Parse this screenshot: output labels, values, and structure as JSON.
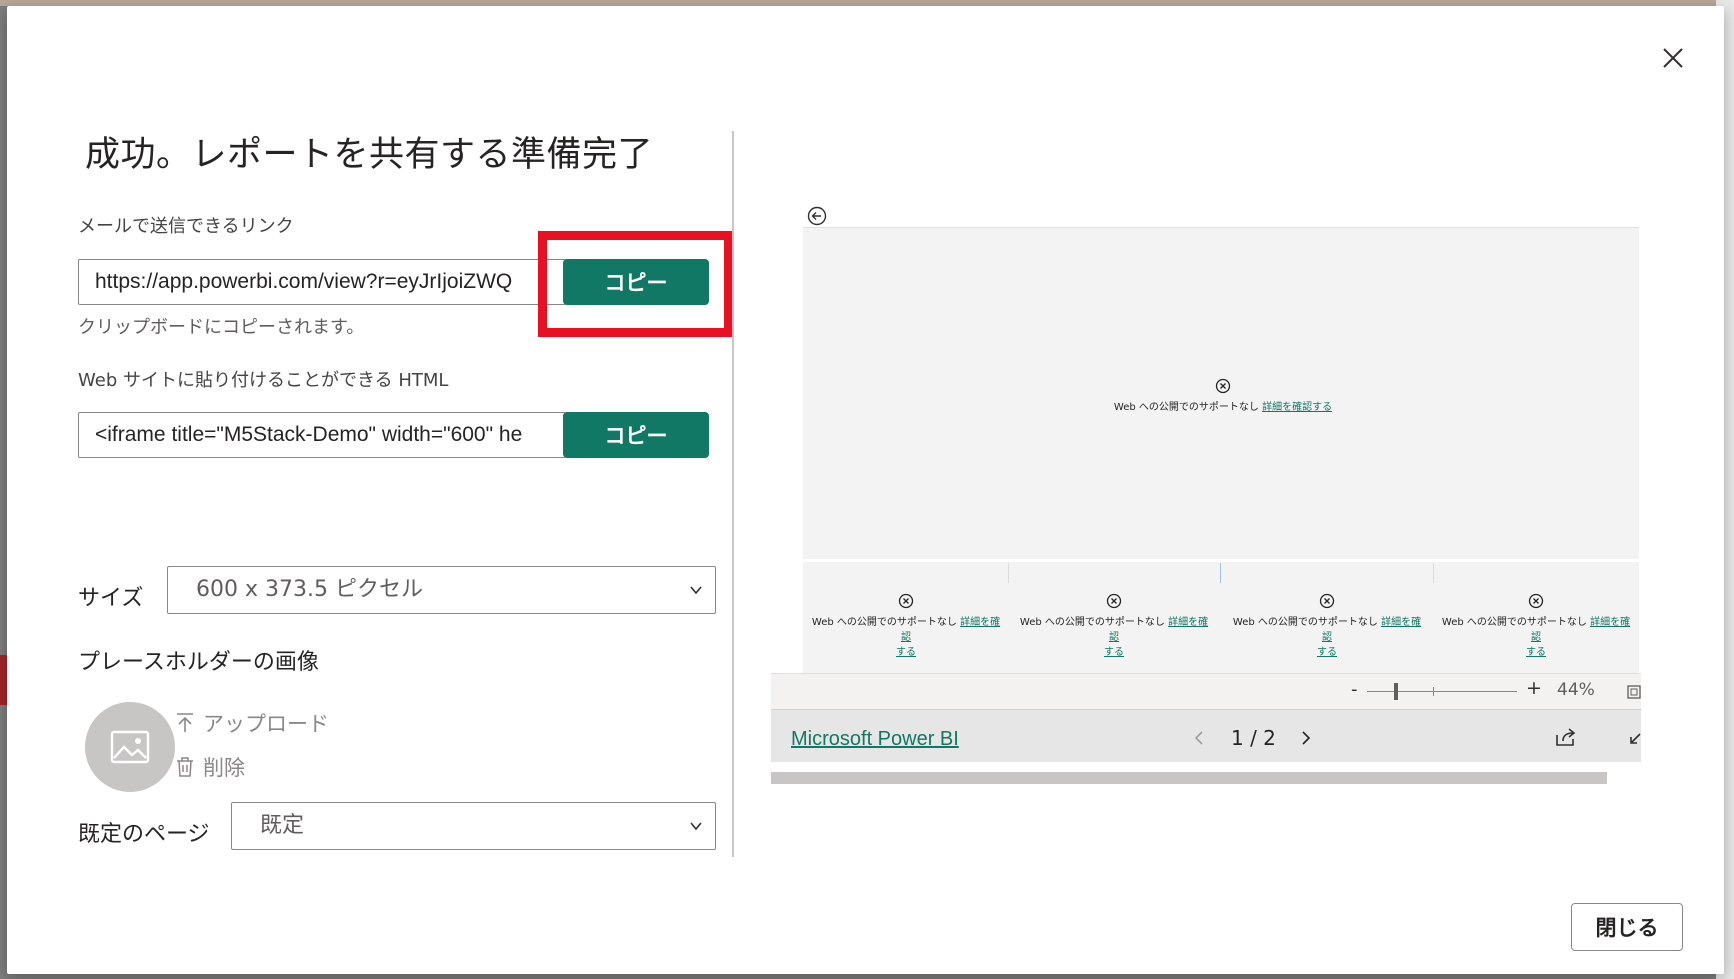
{
  "dialog": {
    "title": "成功。レポートを共有する準備完了",
    "close_icon": "close-icon"
  },
  "link_section": {
    "label": "メールで送信できるリンク",
    "value": "https://app.powerbi.com/view?r=eyJrIjoiZWQ",
    "copy_label": "コピー",
    "hint": "クリップボードにコピーされます。"
  },
  "html_section": {
    "label": "Web サイトに貼り付けることができる HTML",
    "value": "<iframe title=\"M5Stack-Demo\" width=\"600\" he",
    "copy_label": "コピー"
  },
  "size": {
    "label": "サイズ",
    "selected": "600 x 373.5 ピクセル"
  },
  "placeholder": {
    "label": "プレースホルダーの画像",
    "upload": "アップロード",
    "delete": "削除"
  },
  "default_page": {
    "label": "既定のページ",
    "selected": "既定"
  },
  "preview": {
    "main_message": "Web への公開でのサポートなし",
    "main_link": "詳細を確認する",
    "tiles": [
      {
        "message": "Web への公開でのサポートなし",
        "link": "詳細を確認",
        "link2": "する"
      },
      {
        "message": "Web への公開でのサポートなし",
        "link": "詳細を確認",
        "link2": "する"
      },
      {
        "message": "Web への公開でのサポートなし",
        "link": "詳細を確認",
        "link2": "する"
      },
      {
        "message": "Web への公開でのサポートなし",
        "link": "詳細を確認",
        "link2": "する"
      }
    ],
    "zoom": {
      "minus": "-",
      "plus": "+",
      "percent": "44%",
      "value_percent": 44
    },
    "footer": {
      "brand_link": "Microsoft Power BI",
      "page_indicator": "1 / 2"
    }
  },
  "footer": {
    "close_label": "閉じる"
  },
  "colors": {
    "accent": "#117865",
    "highlight": "#e81123"
  }
}
